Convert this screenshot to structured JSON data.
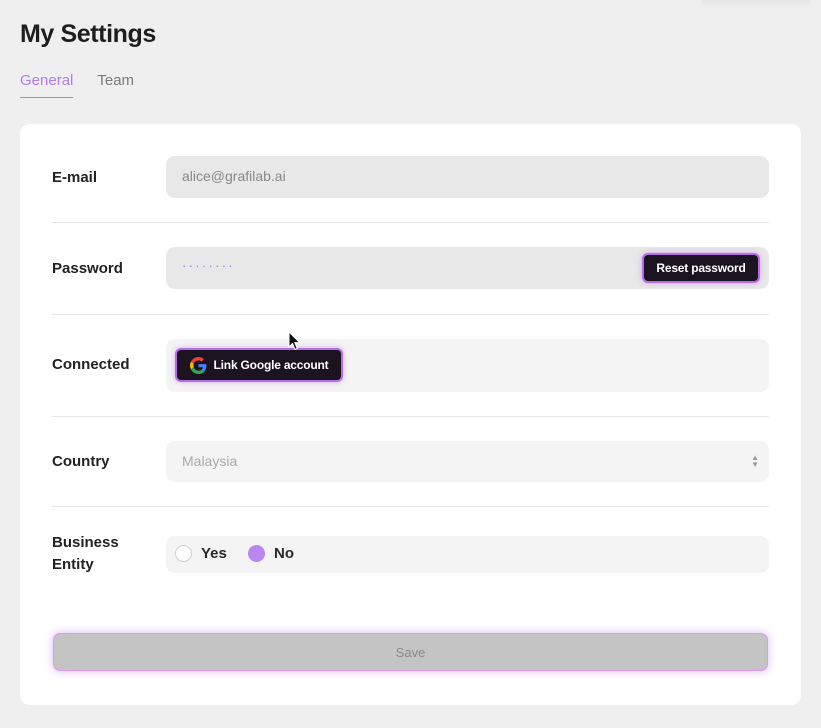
{
  "page": {
    "title": "My Settings"
  },
  "tabs": [
    {
      "label": "General",
      "active": true
    },
    {
      "label": "Team",
      "active": false
    }
  ],
  "form": {
    "email": {
      "label": "E-mail",
      "value": "alice@grafilab.ai"
    },
    "password": {
      "label": "Password",
      "value": "········",
      "reset_label": "Reset password"
    },
    "connected": {
      "label": "Connected",
      "google_label": "Link Google account"
    },
    "country": {
      "label": "Country",
      "value": "Malaysia"
    },
    "business_entity": {
      "label_line1": "Business",
      "label_line2": "Entity",
      "options": [
        {
          "label": "Yes",
          "selected": false
        },
        {
          "label": "No",
          "selected": true
        }
      ]
    },
    "save_label": "Save"
  },
  "colors": {
    "accent": "#b57bec",
    "dark_button": "#1b1320",
    "background": "#efefef"
  }
}
